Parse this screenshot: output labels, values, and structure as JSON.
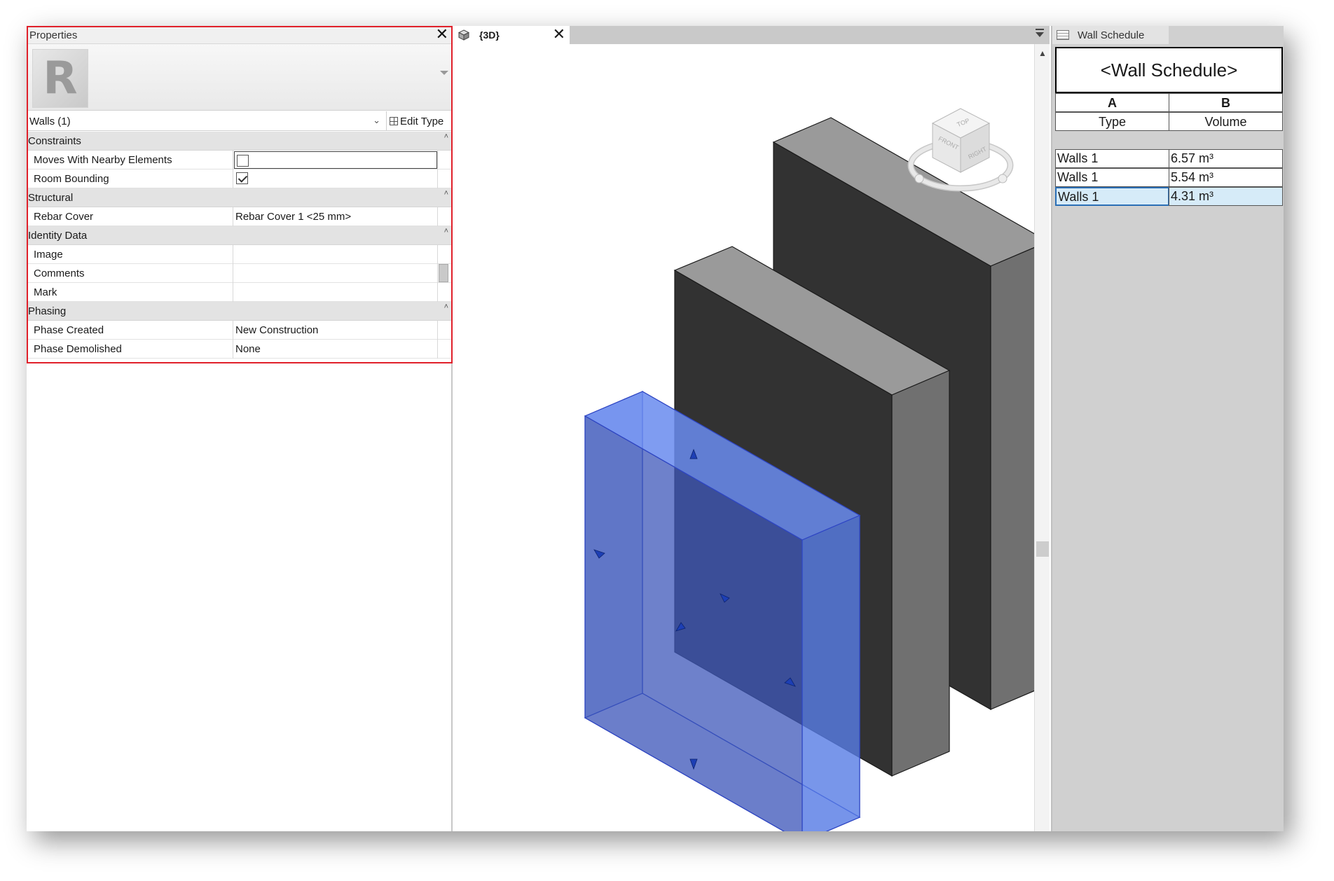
{
  "properties": {
    "title": "Properties",
    "type_selector": "Walls (1)",
    "edit_type_label": "Edit Type",
    "categories": [
      {
        "label": "Constraints",
        "rows": [
          {
            "name": "Moves With Nearby Elements",
            "type": "checkbox",
            "checked": false
          },
          {
            "name": "Room Bounding",
            "type": "checkbox",
            "checked": true
          }
        ]
      },
      {
        "label": "Structural",
        "rows": [
          {
            "name": "Rebar Cover",
            "type": "text",
            "value": "Rebar Cover 1 <25 mm>"
          }
        ]
      },
      {
        "label": "Identity Data",
        "rows": [
          {
            "name": "Image",
            "type": "text",
            "value": ""
          },
          {
            "name": "Comments",
            "type": "text",
            "value": ""
          },
          {
            "name": "Mark",
            "type": "text",
            "value": ""
          }
        ]
      },
      {
        "label": "Phasing",
        "rows": [
          {
            "name": "Phase Created",
            "type": "text",
            "value": "New Construction"
          },
          {
            "name": "Phase Demolished",
            "type": "text",
            "value": "None"
          }
        ]
      }
    ]
  },
  "view": {
    "tab_label": "{3D}",
    "viewcube_faces": {
      "top": "TOP",
      "front": "FRONT",
      "right": "RIGHT"
    }
  },
  "schedule": {
    "tab_label": "Wall Schedule",
    "title": "<Wall Schedule>",
    "column_letters": [
      "A",
      "B"
    ],
    "column_headers": [
      "Type",
      "Volume"
    ],
    "rows": [
      [
        "Walls 1",
        "6.57 m³"
      ],
      [
        "Walls 1",
        "5.54 m³"
      ],
      [
        "Walls 1",
        "4.31 m³"
      ]
    ]
  },
  "colors": {
    "highlight": "#e0202a",
    "selected_wall": "#5a78d6",
    "wall_dark": "#323232",
    "wall_top": "#9a9a9a",
    "wall_side": "#707070",
    "selected_cell": "#d6ebf8"
  }
}
